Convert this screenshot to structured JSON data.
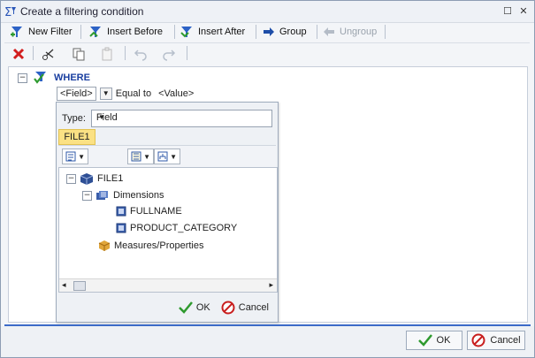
{
  "window": {
    "title": "Create a filtering condition",
    "controls": {
      "maximize": "☐",
      "close": "✕"
    }
  },
  "toolbar": {
    "new_filter": "New Filter",
    "insert_before": "Insert Before",
    "insert_after": "Insert After",
    "group": "Group",
    "ungroup": "Ungroup"
  },
  "condition": {
    "where_label": "WHERE",
    "field": "<Field>",
    "operator": "Equal to",
    "value": "<Value>"
  },
  "popup": {
    "type_label": "Type:",
    "type_value": "Field",
    "file_tab": "FILE1",
    "tree": {
      "root": "FILE1",
      "dimensions": "Dimensions",
      "fullname": "FULLNAME",
      "product_category": "PRODUCT_CATEGORY",
      "measures": "Measures/Properties"
    },
    "ok": "OK",
    "cancel": "Cancel"
  },
  "footer": {
    "ok": "OK",
    "cancel": "Cancel"
  },
  "colors": {
    "accent": "#3c6bc8",
    "where_text": "#1a3fa0",
    "tab_highlight": "#fbe184"
  }
}
